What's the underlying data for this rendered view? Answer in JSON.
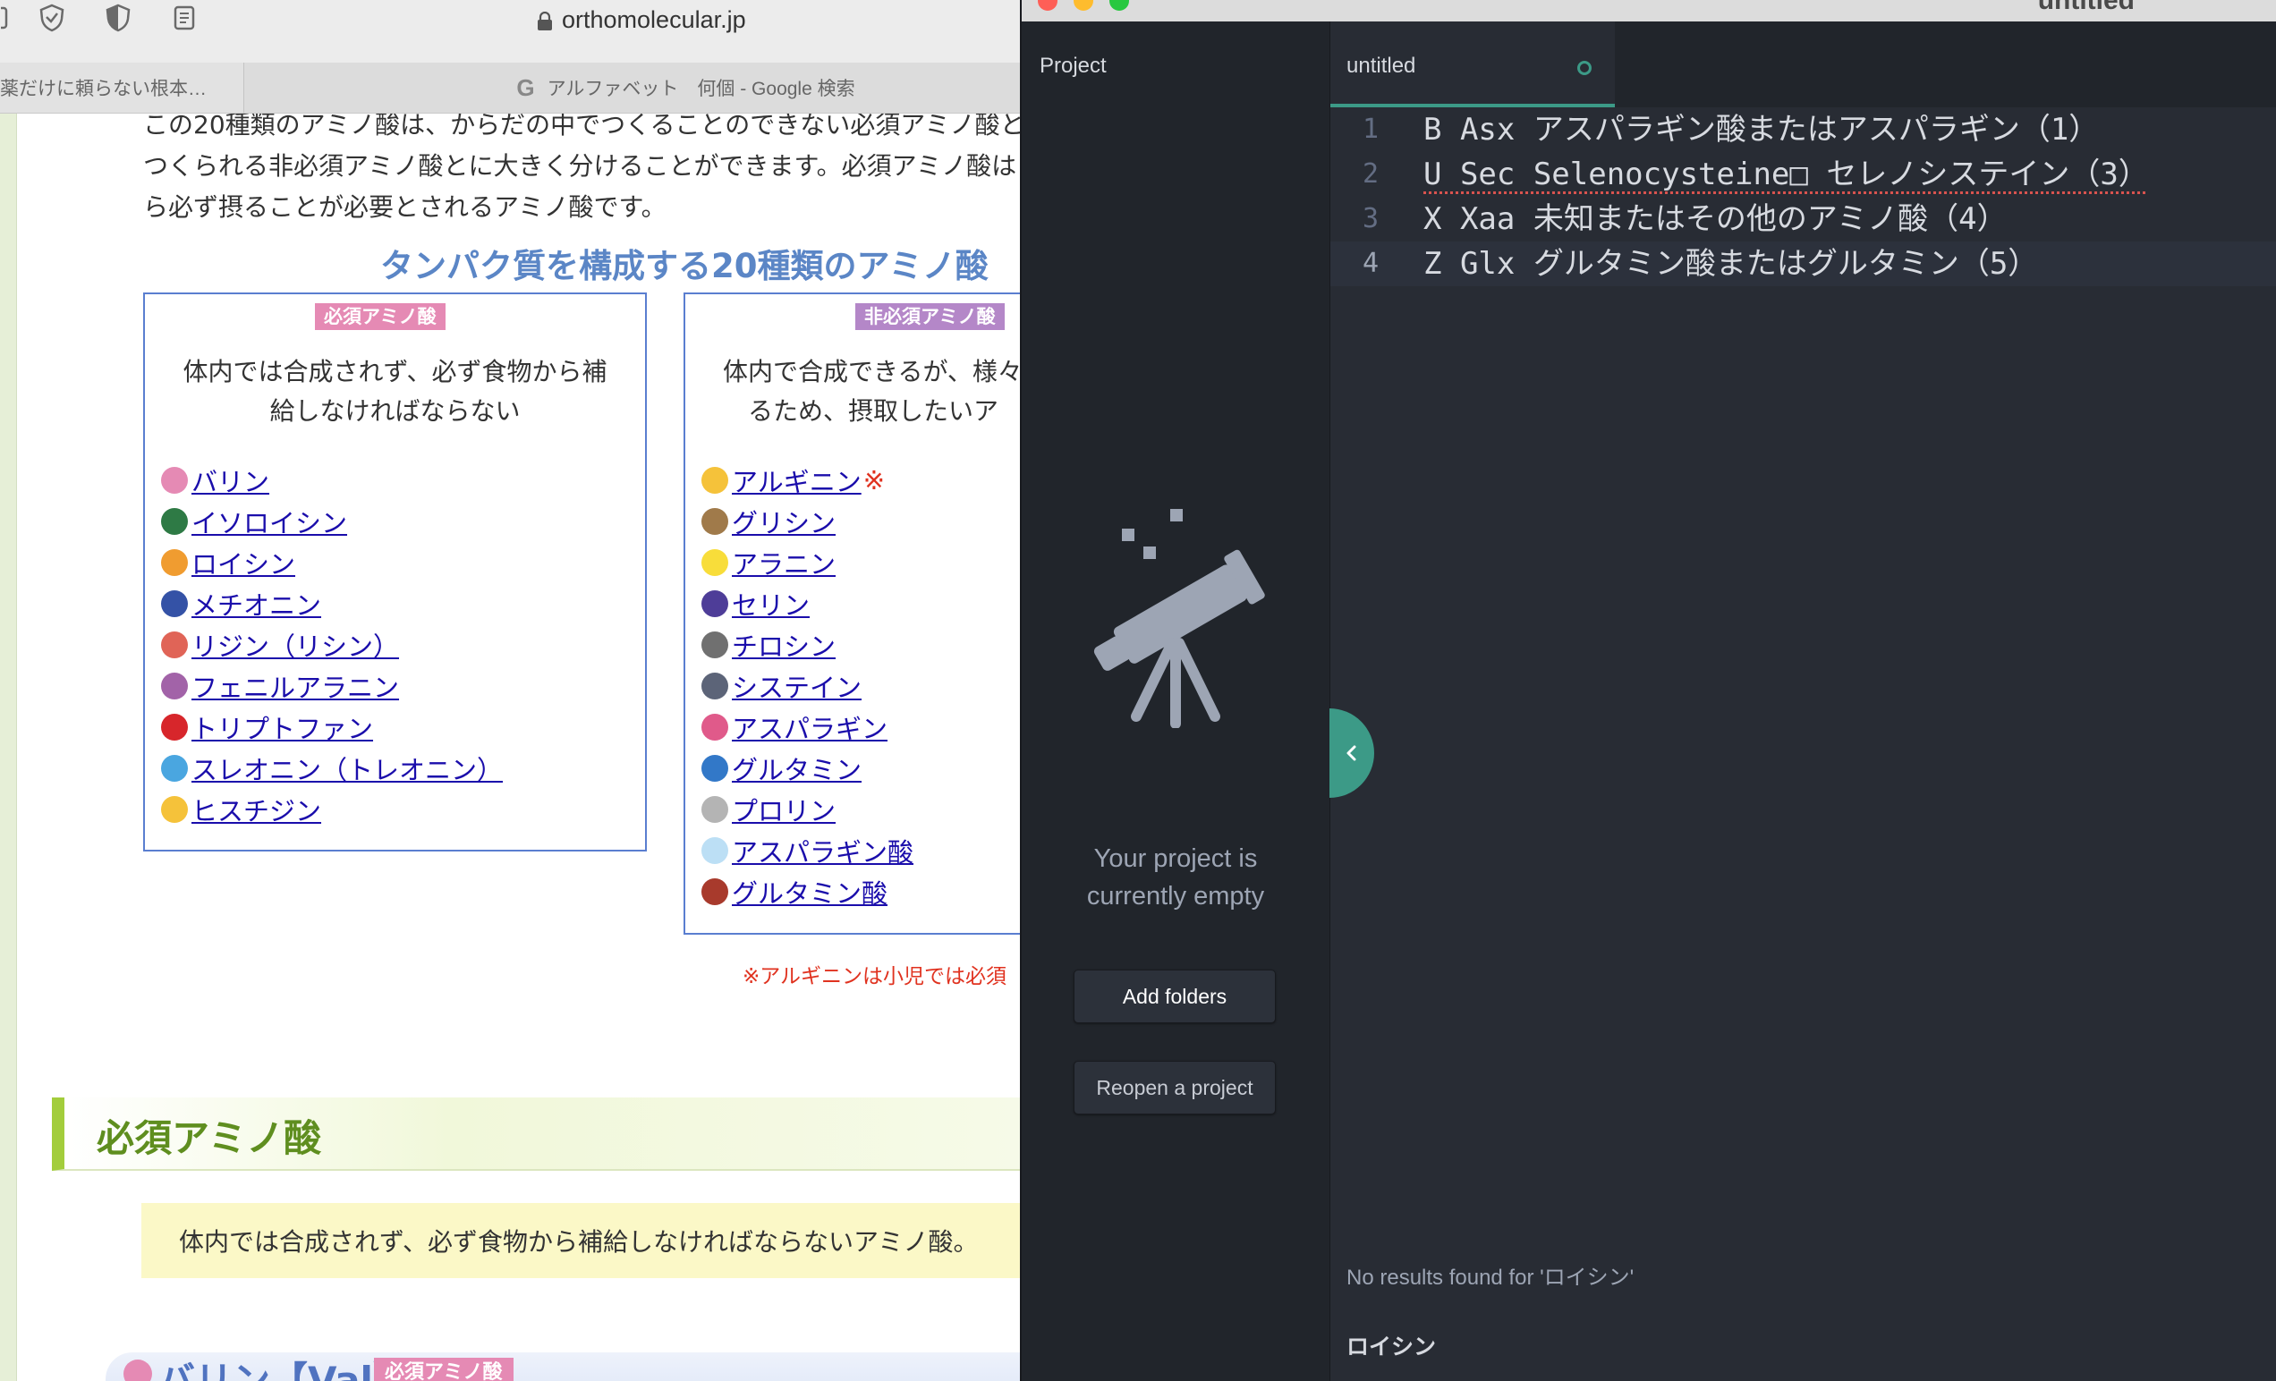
{
  "browser": {
    "url": "orthomolecular.jp",
    "tabs": [
      "薬だけに頼らない根本…",
      "アルファベット　何個 - Google 検索"
    ],
    "tab2_icon": "google-g-icon",
    "intro_lines": [
      "この20種類のアミノ酸は、からだの中でつくることのできない必須アミノ酸と",
      "つくられる非必須アミノ酸とに大きく分けることができます。必須アミノ酸は",
      "ら必ず摂ることが必要とされるアミノ酸です。"
    ],
    "heading": "タンパク質を構成する20種類のアミノ酸",
    "essential": {
      "badge": "必須アミノ酸",
      "description": "体内では合成されず、必ず食物から補\n給しなければならない",
      "items": [
        {
          "name": "バリン",
          "color": "#e58ab4"
        },
        {
          "name": "イソロイシン",
          "color": "#2e7a45"
        },
        {
          "name": "ロイシン",
          "color": "#f09c30"
        },
        {
          "name": "メチオニン",
          "color": "#3452a6"
        },
        {
          "name": "リジン（リシン）",
          "color": "#e06457"
        },
        {
          "name": "フェニルアラニン",
          "color": "#a263a8"
        },
        {
          "name": "トリプトファン",
          "color": "#d7262b"
        },
        {
          "name": "スレオニン（トレオニン）",
          "color": "#4aa6e0"
        },
        {
          "name": "ヒスチジン",
          "color": "#f5c23a"
        }
      ]
    },
    "nonessential": {
      "badge": "非必須アミノ酸",
      "description": "体内で合成できるが、様々\n　るため、摂取したいア",
      "items": [
        {
          "name": "アルギニン",
          "color": "#f5c23a",
          "mark": "※"
        },
        {
          "name": "グリシン",
          "color": "#a07a4a"
        },
        {
          "name": "アラニン",
          "color": "#f8dd3a"
        },
        {
          "name": "セリン",
          "color": "#4e3d98"
        },
        {
          "name": "チロシン",
          "color": "#707070"
        },
        {
          "name": "システイン",
          "color": "#5c6478"
        },
        {
          "name": "アスパラギン",
          "color": "#e05a8a"
        },
        {
          "name": "グルタミン",
          "color": "#3278c8"
        },
        {
          "name": "プロリン",
          "color": "#b4b4b4"
        },
        {
          "name": "アスパラギン酸",
          "color": "#bcdff5"
        },
        {
          "name": "グルタミン酸",
          "color": "#a83a2c"
        }
      ]
    },
    "note": "※アルギニンは小児では必須",
    "section_heading": "必須アミノ酸",
    "section_text": "体内では合成されず、必ず食物から補給しなければならないアミノ酸。",
    "val_heading": "バリン【Val】",
    "val_badge": "必須アミノ酸"
  },
  "editor": {
    "window_title": "untitled",
    "traffic_colors": [
      "#fe5f57",
      "#febc2e",
      "#28c840"
    ],
    "tree_title": "Project",
    "empty_message": "Your project is\ncurrently empty",
    "add_folders": "Add folders",
    "reopen_project": "Reopen a project",
    "tab_name": "untitled",
    "accent": "#3c9a87",
    "lines": [
      {
        "num": "1",
        "text": "B Asx アスパラギン酸またはアスパラギン（1）"
      },
      {
        "num": "2",
        "text": "U Sec Selenocysteine□ セレノシステイン（3）"
      },
      {
        "num": "3",
        "text": "X Xaa 未知またはその他のアミノ酸（4）"
      },
      {
        "num": "4",
        "text": "Z Glx グルタミン酸またはグルタミン（5）"
      }
    ],
    "results_message": "No results found for 'ロイシン'",
    "search_term": "ロイシン"
  }
}
